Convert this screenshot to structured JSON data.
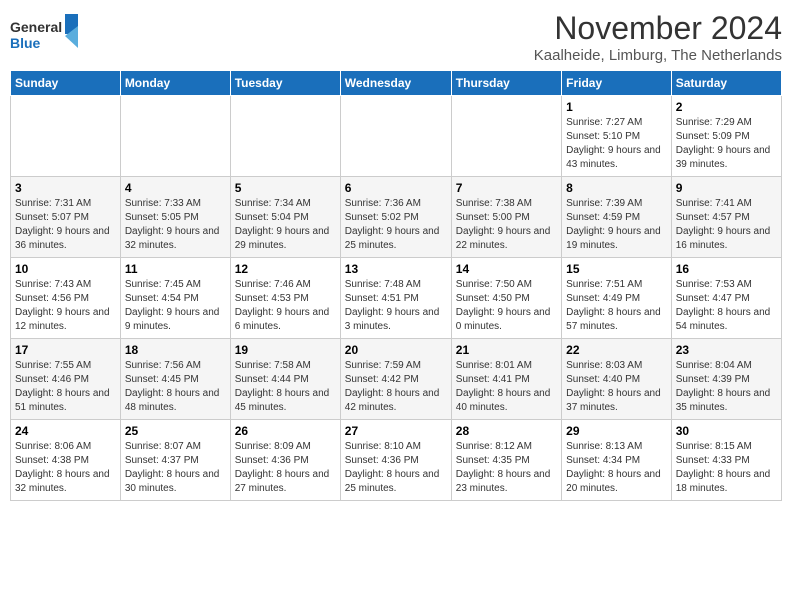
{
  "header": {
    "logo_line1": "General",
    "logo_line2": "Blue",
    "month": "November 2024",
    "location": "Kaalheide, Limburg, The Netherlands"
  },
  "weekdays": [
    "Sunday",
    "Monday",
    "Tuesday",
    "Wednesday",
    "Thursday",
    "Friday",
    "Saturday"
  ],
  "weeks": [
    [
      {
        "day": "",
        "info": ""
      },
      {
        "day": "",
        "info": ""
      },
      {
        "day": "",
        "info": ""
      },
      {
        "day": "",
        "info": ""
      },
      {
        "day": "",
        "info": ""
      },
      {
        "day": "1",
        "info": "Sunrise: 7:27 AM\nSunset: 5:10 PM\nDaylight: 9 hours and 43 minutes."
      },
      {
        "day": "2",
        "info": "Sunrise: 7:29 AM\nSunset: 5:09 PM\nDaylight: 9 hours and 39 minutes."
      }
    ],
    [
      {
        "day": "3",
        "info": "Sunrise: 7:31 AM\nSunset: 5:07 PM\nDaylight: 9 hours and 36 minutes."
      },
      {
        "day": "4",
        "info": "Sunrise: 7:33 AM\nSunset: 5:05 PM\nDaylight: 9 hours and 32 minutes."
      },
      {
        "day": "5",
        "info": "Sunrise: 7:34 AM\nSunset: 5:04 PM\nDaylight: 9 hours and 29 minutes."
      },
      {
        "day": "6",
        "info": "Sunrise: 7:36 AM\nSunset: 5:02 PM\nDaylight: 9 hours and 25 minutes."
      },
      {
        "day": "7",
        "info": "Sunrise: 7:38 AM\nSunset: 5:00 PM\nDaylight: 9 hours and 22 minutes."
      },
      {
        "day": "8",
        "info": "Sunrise: 7:39 AM\nSunset: 4:59 PM\nDaylight: 9 hours and 19 minutes."
      },
      {
        "day": "9",
        "info": "Sunrise: 7:41 AM\nSunset: 4:57 PM\nDaylight: 9 hours and 16 minutes."
      }
    ],
    [
      {
        "day": "10",
        "info": "Sunrise: 7:43 AM\nSunset: 4:56 PM\nDaylight: 9 hours and 12 minutes."
      },
      {
        "day": "11",
        "info": "Sunrise: 7:45 AM\nSunset: 4:54 PM\nDaylight: 9 hours and 9 minutes."
      },
      {
        "day": "12",
        "info": "Sunrise: 7:46 AM\nSunset: 4:53 PM\nDaylight: 9 hours and 6 minutes."
      },
      {
        "day": "13",
        "info": "Sunrise: 7:48 AM\nSunset: 4:51 PM\nDaylight: 9 hours and 3 minutes."
      },
      {
        "day": "14",
        "info": "Sunrise: 7:50 AM\nSunset: 4:50 PM\nDaylight: 9 hours and 0 minutes."
      },
      {
        "day": "15",
        "info": "Sunrise: 7:51 AM\nSunset: 4:49 PM\nDaylight: 8 hours and 57 minutes."
      },
      {
        "day": "16",
        "info": "Sunrise: 7:53 AM\nSunset: 4:47 PM\nDaylight: 8 hours and 54 minutes."
      }
    ],
    [
      {
        "day": "17",
        "info": "Sunrise: 7:55 AM\nSunset: 4:46 PM\nDaylight: 8 hours and 51 minutes."
      },
      {
        "day": "18",
        "info": "Sunrise: 7:56 AM\nSunset: 4:45 PM\nDaylight: 8 hours and 48 minutes."
      },
      {
        "day": "19",
        "info": "Sunrise: 7:58 AM\nSunset: 4:44 PM\nDaylight: 8 hours and 45 minutes."
      },
      {
        "day": "20",
        "info": "Sunrise: 7:59 AM\nSunset: 4:42 PM\nDaylight: 8 hours and 42 minutes."
      },
      {
        "day": "21",
        "info": "Sunrise: 8:01 AM\nSunset: 4:41 PM\nDaylight: 8 hours and 40 minutes."
      },
      {
        "day": "22",
        "info": "Sunrise: 8:03 AM\nSunset: 4:40 PM\nDaylight: 8 hours and 37 minutes."
      },
      {
        "day": "23",
        "info": "Sunrise: 8:04 AM\nSunset: 4:39 PM\nDaylight: 8 hours and 35 minutes."
      }
    ],
    [
      {
        "day": "24",
        "info": "Sunrise: 8:06 AM\nSunset: 4:38 PM\nDaylight: 8 hours and 32 minutes."
      },
      {
        "day": "25",
        "info": "Sunrise: 8:07 AM\nSunset: 4:37 PM\nDaylight: 8 hours and 30 minutes."
      },
      {
        "day": "26",
        "info": "Sunrise: 8:09 AM\nSunset: 4:36 PM\nDaylight: 8 hours and 27 minutes."
      },
      {
        "day": "27",
        "info": "Sunrise: 8:10 AM\nSunset: 4:36 PM\nDaylight: 8 hours and 25 minutes."
      },
      {
        "day": "28",
        "info": "Sunrise: 8:12 AM\nSunset: 4:35 PM\nDaylight: 8 hours and 23 minutes."
      },
      {
        "day": "29",
        "info": "Sunrise: 8:13 AM\nSunset: 4:34 PM\nDaylight: 8 hours and 20 minutes."
      },
      {
        "day": "30",
        "info": "Sunrise: 8:15 AM\nSunset: 4:33 PM\nDaylight: 8 hours and 18 minutes."
      }
    ]
  ]
}
